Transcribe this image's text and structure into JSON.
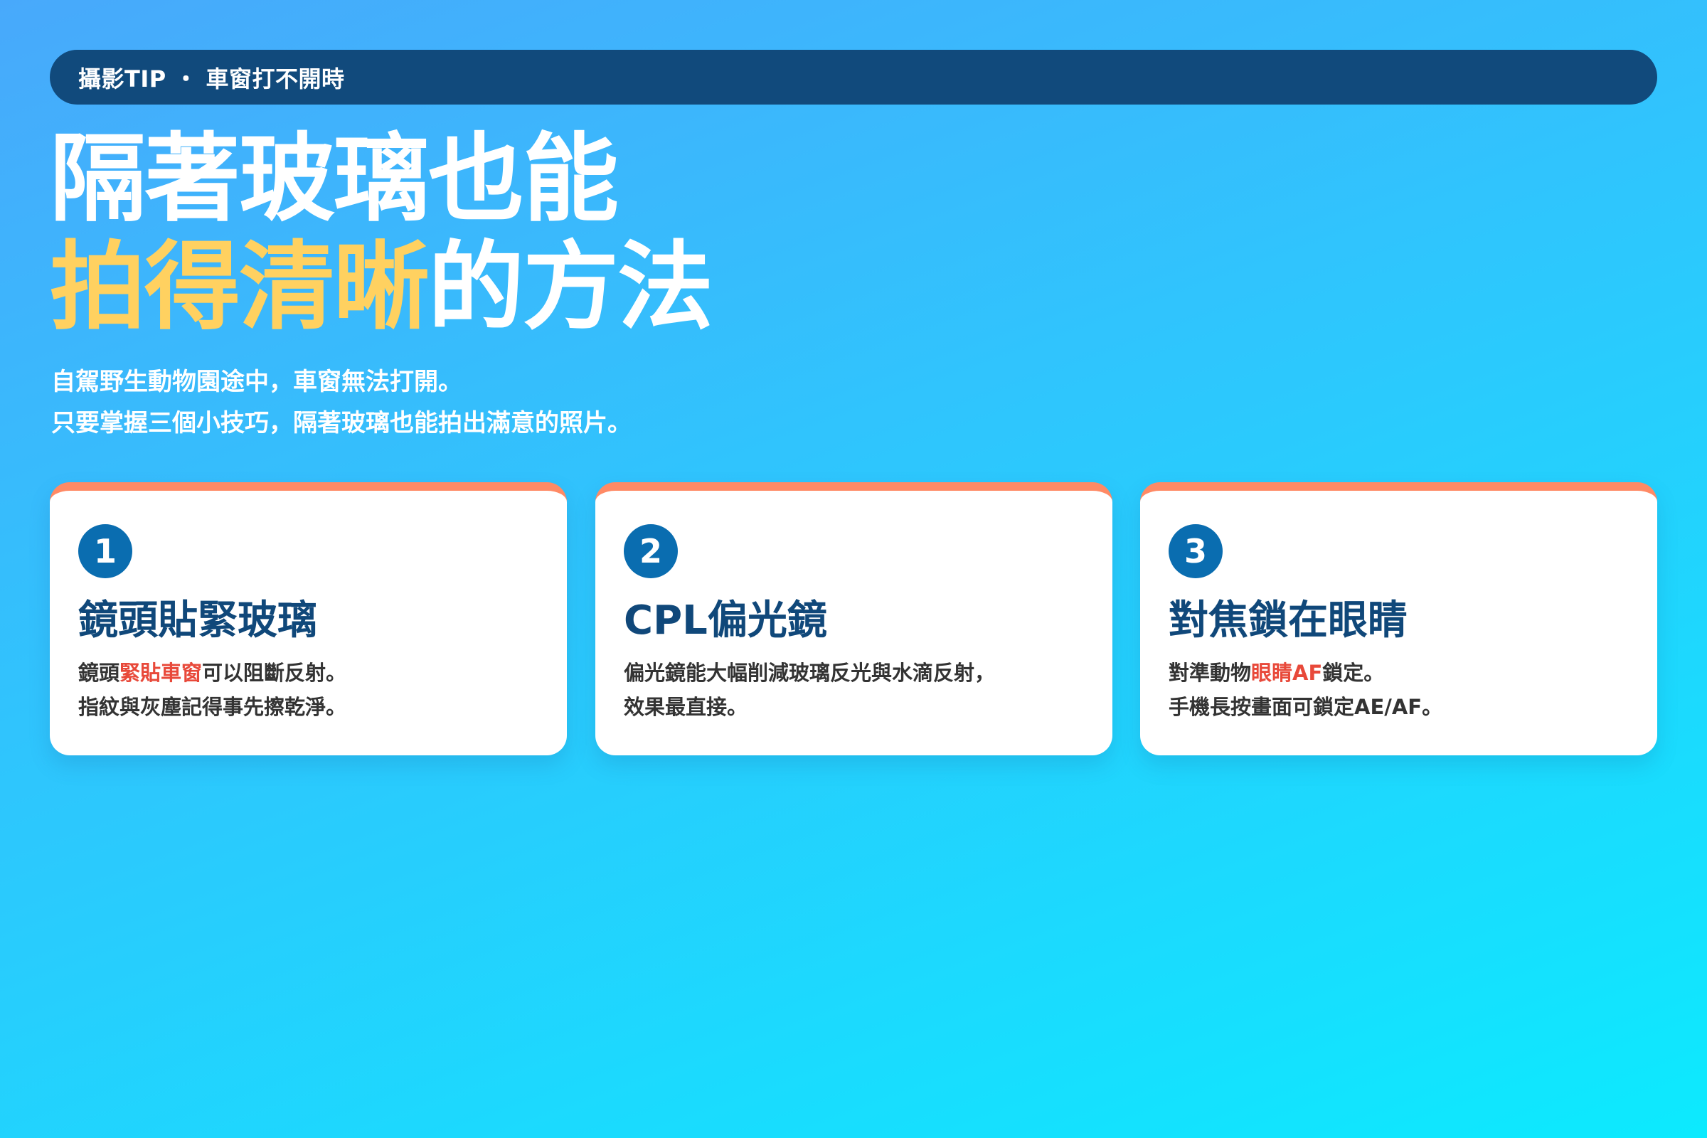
{
  "header": {
    "tag": "攝影TIP ・ 車窗打不開時"
  },
  "title": {
    "line1": "隔著玻璃也能",
    "line2_highlight": "拍得清晰",
    "line2_rest": "的方法"
  },
  "subtitle": {
    "line1": "自駕野生動物園途中，車窗無法打開。",
    "line2": "只要掌握三個小技巧，隔著玻璃也能拍出滿意的照片。"
  },
  "tips": [
    {
      "number": "1",
      "title": "鏡頭貼緊玻璃",
      "body_line1_pre": "鏡頭",
      "body_line1_em": "緊貼車窗",
      "body_line1_post": "可以阻斷反射。",
      "body_line2": "指紋與灰塵記得事先擦乾淨。"
    },
    {
      "number": "2",
      "title": "CPL偏光鏡",
      "body_line1": "偏光鏡能大幅削減玻璃反光與水滴反射，",
      "body_line2": "效果最直接。"
    },
    {
      "number": "3",
      "title": "對焦鎖在眼睛",
      "body_line1_pre": "對準動物",
      "body_line1_em": "眼睛AF",
      "body_line1_post": "鎖定。",
      "body_line2": "手機長按畫面可鎖定AE/AF。"
    }
  ],
  "colors": {
    "header_bar": "#114a7c",
    "title_highlight": "#ffd160",
    "card_accent": "#ff8a65",
    "badge": "#0a6db0",
    "card_title": "#10487a",
    "emphasis": "#e8493a"
  }
}
